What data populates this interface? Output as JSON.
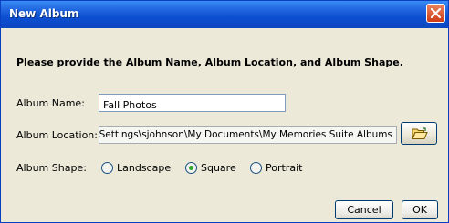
{
  "window": {
    "title": "New Album"
  },
  "instruction": "Please provide the Album Name, Album Location, and Album Shape.",
  "fields": {
    "name_label": "Album Name:",
    "name_value": "Fall Photos",
    "location_label": "Album Location:",
    "location_value": "C:\\Documents and Settings\\sjohnson\\My Documents\\My Memories Suite Albums"
  },
  "shape": {
    "label": "Album Shape:",
    "options": [
      "Landscape",
      "Square",
      "Portrait"
    ],
    "selected": "Square"
  },
  "buttons": {
    "cancel": "Cancel",
    "ok": "OK"
  },
  "icons": {
    "close": "close-icon",
    "browse": "folder-open-icon"
  }
}
